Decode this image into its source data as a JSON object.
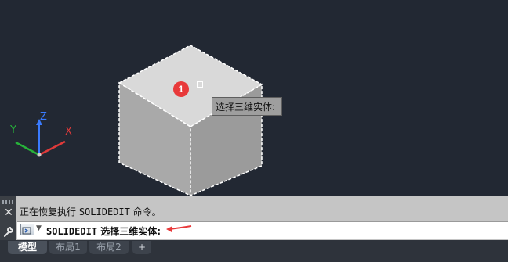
{
  "viewport": {
    "tooltip": "选择三维实体:",
    "marker_number": "1",
    "axes": {
      "x": "X",
      "y": "Y",
      "z": "Z"
    }
  },
  "command_panel": {
    "close_icon": "✕",
    "history_prefix": "正在恢复执行 ",
    "history_command": "SOLIDEDIT",
    "history_suffix": " 命令。",
    "prompt_command": "SOLIDEDIT",
    "prompt_text": " 选择三维实体:"
  },
  "tabs": [
    "模型",
    "布局1",
    "布局2",
    "+"
  ],
  "colors": {
    "canvas_bg": "#222833",
    "cube_top": "#d9d9d9",
    "cube_left": "#a8a8a8",
    "cube_right": "#9a9a9a",
    "annotation_red": "#e8393a"
  }
}
